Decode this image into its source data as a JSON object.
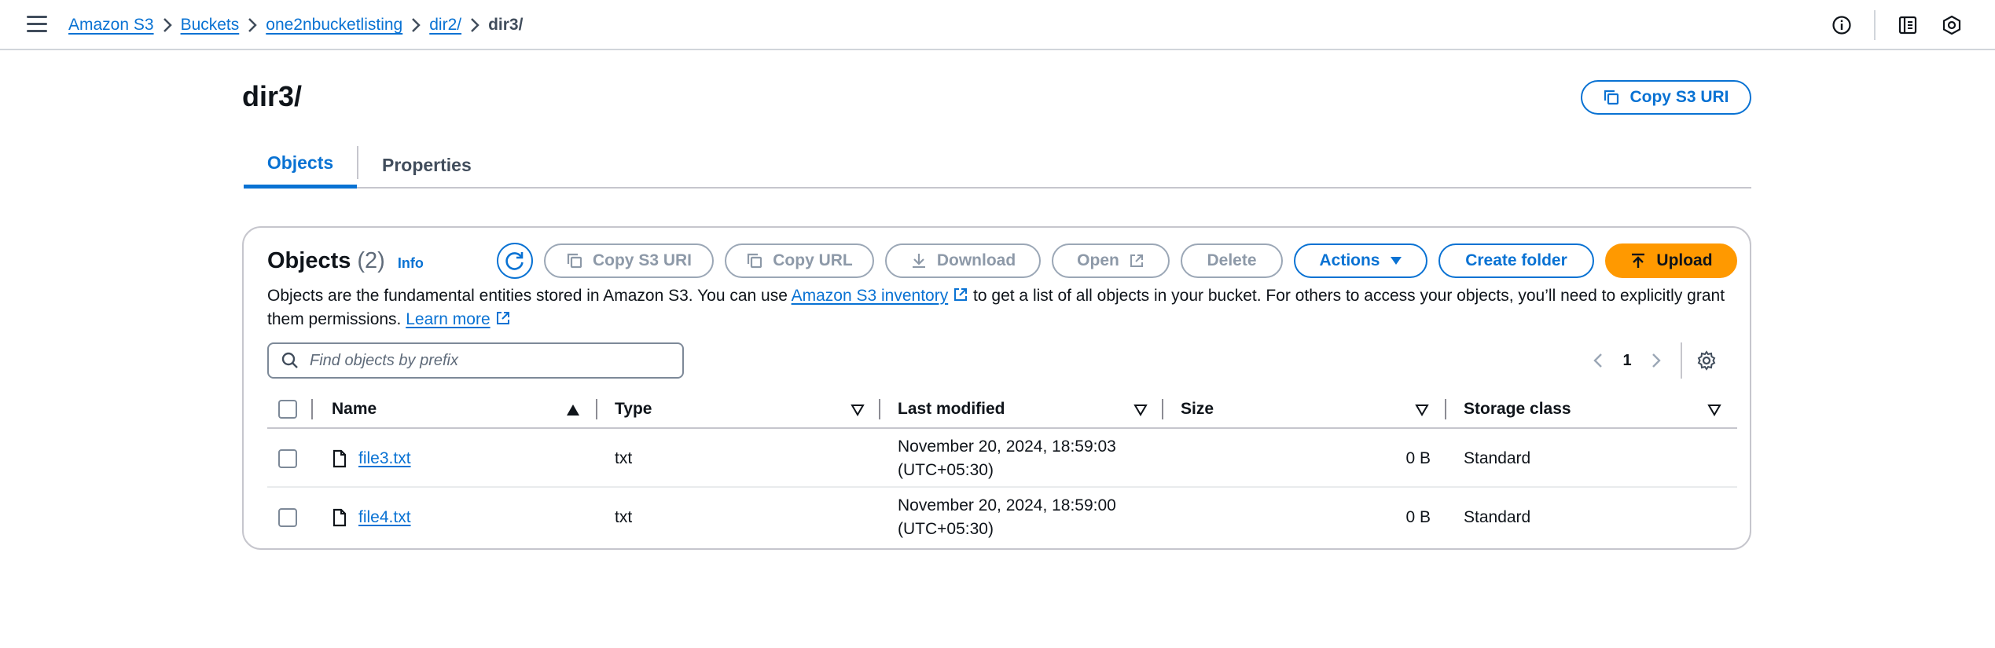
{
  "breadcrumb": {
    "items": [
      "Amazon S3",
      "Buckets",
      "one2nbucketlisting",
      "dir2/"
    ],
    "current": "dir3/"
  },
  "page": {
    "title": "dir3/",
    "copy_uri_label": "Copy S3 URI"
  },
  "tabs": [
    "Objects",
    "Properties"
  ],
  "objects_panel": {
    "title": "Objects",
    "count": "(2)",
    "info_label": "Info",
    "toolbar": {
      "copy_s3_uri": "Copy S3 URI",
      "copy_url": "Copy URL",
      "download": "Download",
      "open": "Open",
      "delete": "Delete",
      "actions": "Actions",
      "create_folder": "Create folder",
      "upload": "Upload"
    },
    "description": {
      "part1": "Objects are the fundamental entities stored in Amazon S3. You can use ",
      "inventory_link": "Amazon S3 inventory",
      "part2": " to get a list of all objects in your bucket. For others to access your objects, you’ll need to explicitly grant them permissions. ",
      "learn_more": "Learn more"
    },
    "search": {
      "placeholder": "Find objects by prefix"
    },
    "pagination": {
      "current_page": "1"
    },
    "table": {
      "columns": [
        "Name",
        "Type",
        "Last modified",
        "Size",
        "Storage class"
      ],
      "rows": [
        {
          "name": "file3.txt",
          "type": "txt",
          "modified_line1": "November 20, 2024, 18:59:03",
          "modified_line2": "(UTC+05:30)",
          "size": "0 B",
          "storage_class": "Standard"
        },
        {
          "name": "file4.txt",
          "type": "txt",
          "modified_line1": "November 20, 2024, 18:59:00",
          "modified_line2": "(UTC+05:30)",
          "size": "0 B",
          "storage_class": "Standard"
        }
      ]
    }
  },
  "colors": {
    "link_blue": "#0972d3",
    "upload_orange": "#ff9900",
    "disabled_gray": "#8d99a8",
    "border_gray": "#c6c6cd"
  },
  "icons": [
    "menu-icon",
    "chevron-right-icon",
    "info-circle-icon",
    "notifications-panel-icon",
    "settings-hexagon-icon",
    "copy-icon",
    "refresh-icon",
    "download-icon",
    "external-link-icon",
    "caret-down-icon",
    "upload-icon",
    "search-icon",
    "angle-left-icon",
    "angle-right-icon",
    "gear-icon",
    "sort-ascending-icon",
    "sort-icon",
    "file-icon"
  ]
}
